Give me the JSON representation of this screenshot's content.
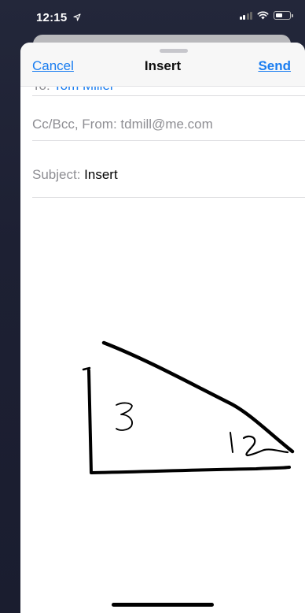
{
  "status_bar": {
    "time": "12:15",
    "location_icon": "location-arrow-icon",
    "icons": [
      "cellular-signal-icon",
      "wifi-icon",
      "battery-icon"
    ]
  },
  "compose": {
    "nav": {
      "cancel_label": "Cancel",
      "title": "Insert",
      "send_label": "Send"
    },
    "to": {
      "label": "To:",
      "value": "Tom Miller"
    },
    "cc_bcc_from": {
      "label": "Cc/Bcc, From:",
      "value": "tdmill@me.com"
    },
    "subject": {
      "label": "Subject:",
      "value": "Insert"
    }
  },
  "body_sketch": {
    "description_labels": [
      "3",
      "1½"
    ]
  },
  "colors": {
    "accent": "#1a7df0",
    "label_gray": "#8e8e93",
    "sheet_background": "#ffffff",
    "backdrop": "#1d2033"
  }
}
